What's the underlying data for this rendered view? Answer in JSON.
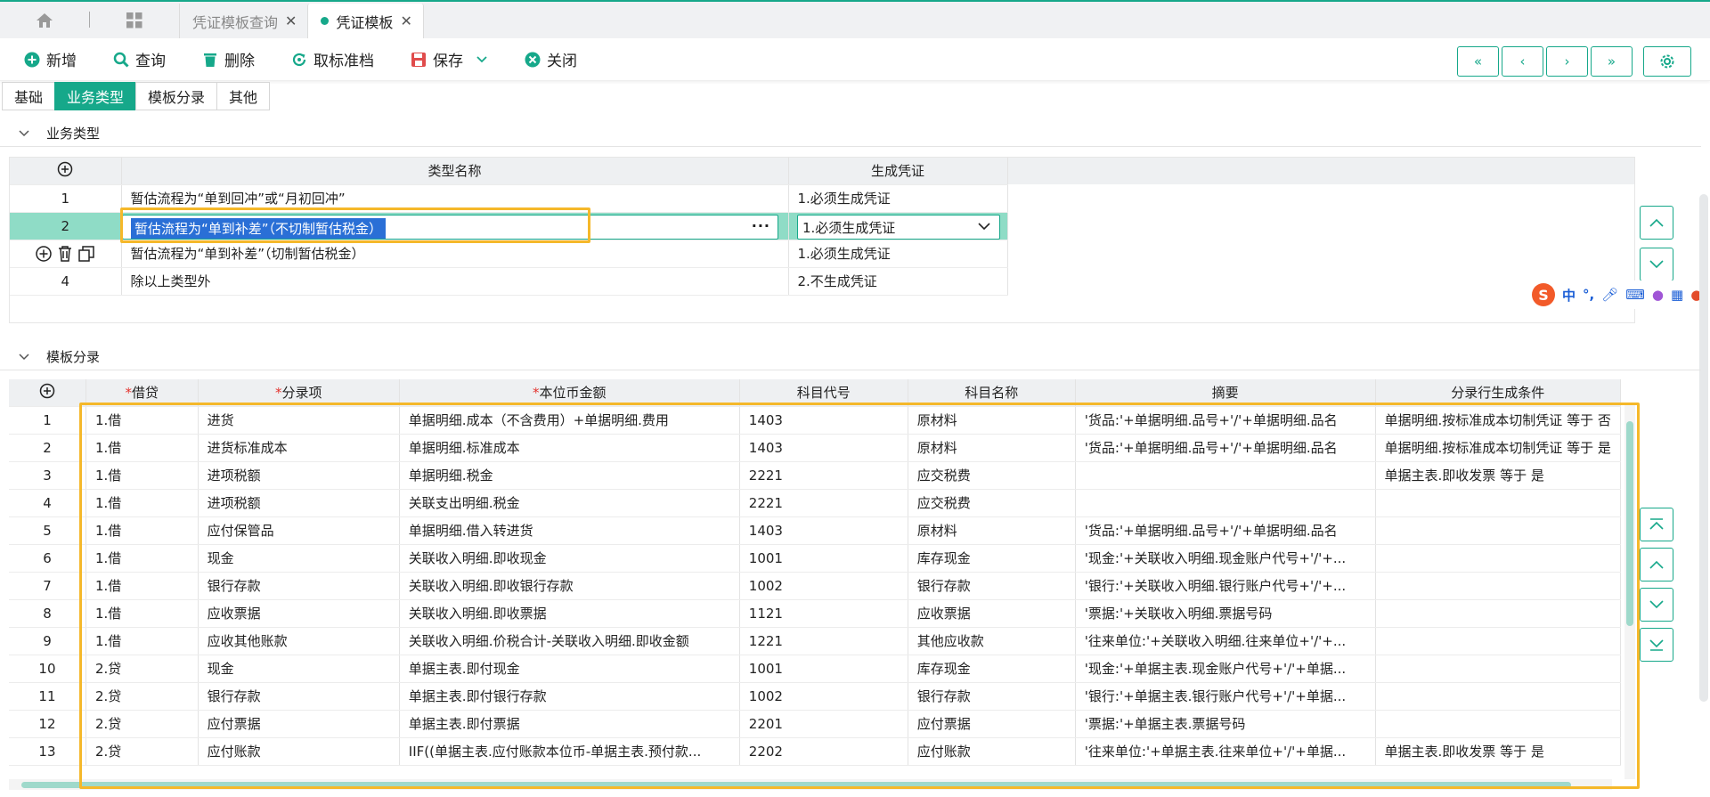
{
  "tabs": [
    {
      "label": "凭证模板查询",
      "active": false
    },
    {
      "label": "凭证模板",
      "active": true
    }
  ],
  "toolbar": {
    "new": "新增",
    "query": "查询",
    "delete": "删除",
    "unstandard": "取标准档",
    "save": "保存",
    "close": "关闭"
  },
  "subtabs": [
    "基础",
    "业务类型",
    "模板分录",
    "其他"
  ],
  "section1": {
    "title": "业务类型"
  },
  "section2": {
    "title": "模板分录"
  },
  "biz_table": {
    "headers": [
      "类型名称",
      "生成凭证"
    ],
    "rows": [
      {
        "idx": "1",
        "name": "暂估流程为“单到回冲”或“月初回冲”",
        "gen": "1.必须生成凭证"
      },
      {
        "idx": "2",
        "name": "暂估流程为“单到补差”（不切制暂估税金）",
        "gen": "1.必须生成凭证"
      },
      {
        "idx": "",
        "name": "暂估流程为“单到补差”（切制暂估税金）",
        "gen": "1.必须生成凭证"
      },
      {
        "idx": "4",
        "name": "除以上类型外",
        "gen": "2.不生成凭证"
      }
    ]
  },
  "tpl_table": {
    "headers": [
      "借贷",
      "分录项",
      "本位币金额",
      "科目代号",
      "科目名称",
      "摘要",
      "分录行生成条件"
    ],
    "rows": [
      [
        "1",
        "1.借",
        "进货",
        "单据明细.成本（不含费用）+单据明细.费用",
        "1403",
        "原材料",
        "'货品:'+单据明细.品号+'/'+单据明细.品名",
        "单据明细.按标准成本切制凭证 等于 否"
      ],
      [
        "2",
        "1.借",
        "进货标准成本",
        "单据明细.标准成本",
        "1403",
        "原材料",
        "'货品:'+单据明细.品号+'/'+单据明细.品名",
        "单据明细.按标准成本切制凭证 等于 是"
      ],
      [
        "3",
        "1.借",
        "进项税额",
        "单据明细.税金",
        "2221",
        "应交税费",
        "",
        "单据主表.即收发票 等于 是"
      ],
      [
        "4",
        "1.借",
        "进项税额",
        "关联支出明细.税金",
        "2221",
        "应交税费",
        "",
        ""
      ],
      [
        "5",
        "1.借",
        "应付保管品",
        "单据明细.借入转进货",
        "1403",
        "原材料",
        "'货品:'+单据明细.品号+'/'+单据明细.品名",
        ""
      ],
      [
        "6",
        "1.借",
        "现金",
        "关联收入明细.即收现金",
        "1001",
        "库存现金",
        "'现金:'+关联收入明细.现金账户代号+'/'+...",
        ""
      ],
      [
        "7",
        "1.借",
        "银行存款",
        "关联收入明细.即收银行存款",
        "1002",
        "银行存款",
        "'银行:'+关联收入明细.银行账户代号+'/'+...",
        ""
      ],
      [
        "8",
        "1.借",
        "应收票据",
        "关联收入明细.即收票据",
        "1121",
        "应收票据",
        "'票据:'+关联收入明细.票据号码",
        ""
      ],
      [
        "9",
        "1.借",
        "应收其他账款",
        "关联收入明细.价税合计-关联收入明细.即收金额",
        "1221",
        "其他应收款",
        "'往来单位:'+关联收入明细.往来单位+'/'+...",
        ""
      ],
      [
        "10",
        "2.贷",
        "现金",
        "单据主表.即付现金",
        "1001",
        "库存现金",
        "'现金:'+单据主表.现金账户代号+'/'+单据...",
        ""
      ],
      [
        "11",
        "2.贷",
        "银行存款",
        "单据主表.即付银行存款",
        "1002",
        "银行存款",
        "'银行:'+单据主表.银行账户代号+'/'+单据...",
        ""
      ],
      [
        "12",
        "2.贷",
        "应付票据",
        "单据主表.即付票据",
        "2201",
        "应付票据",
        "'票据:'+单据主表.票据号码",
        ""
      ],
      [
        "13",
        "2.贷",
        "应付账款",
        "IIF((单据主表.应付账款本位币-单据主表.预付款...",
        "2202",
        "应付账款",
        "'往来单位:'+单据主表.往来单位+'/'+单据...",
        "单据主表.即收发票 等于 是"
      ]
    ]
  },
  "ime": {
    "label": "中"
  },
  "colors": {
    "accent": "#16a88a",
    "highlight": "#f5b82a",
    "selection": "#8fdcc6"
  }
}
